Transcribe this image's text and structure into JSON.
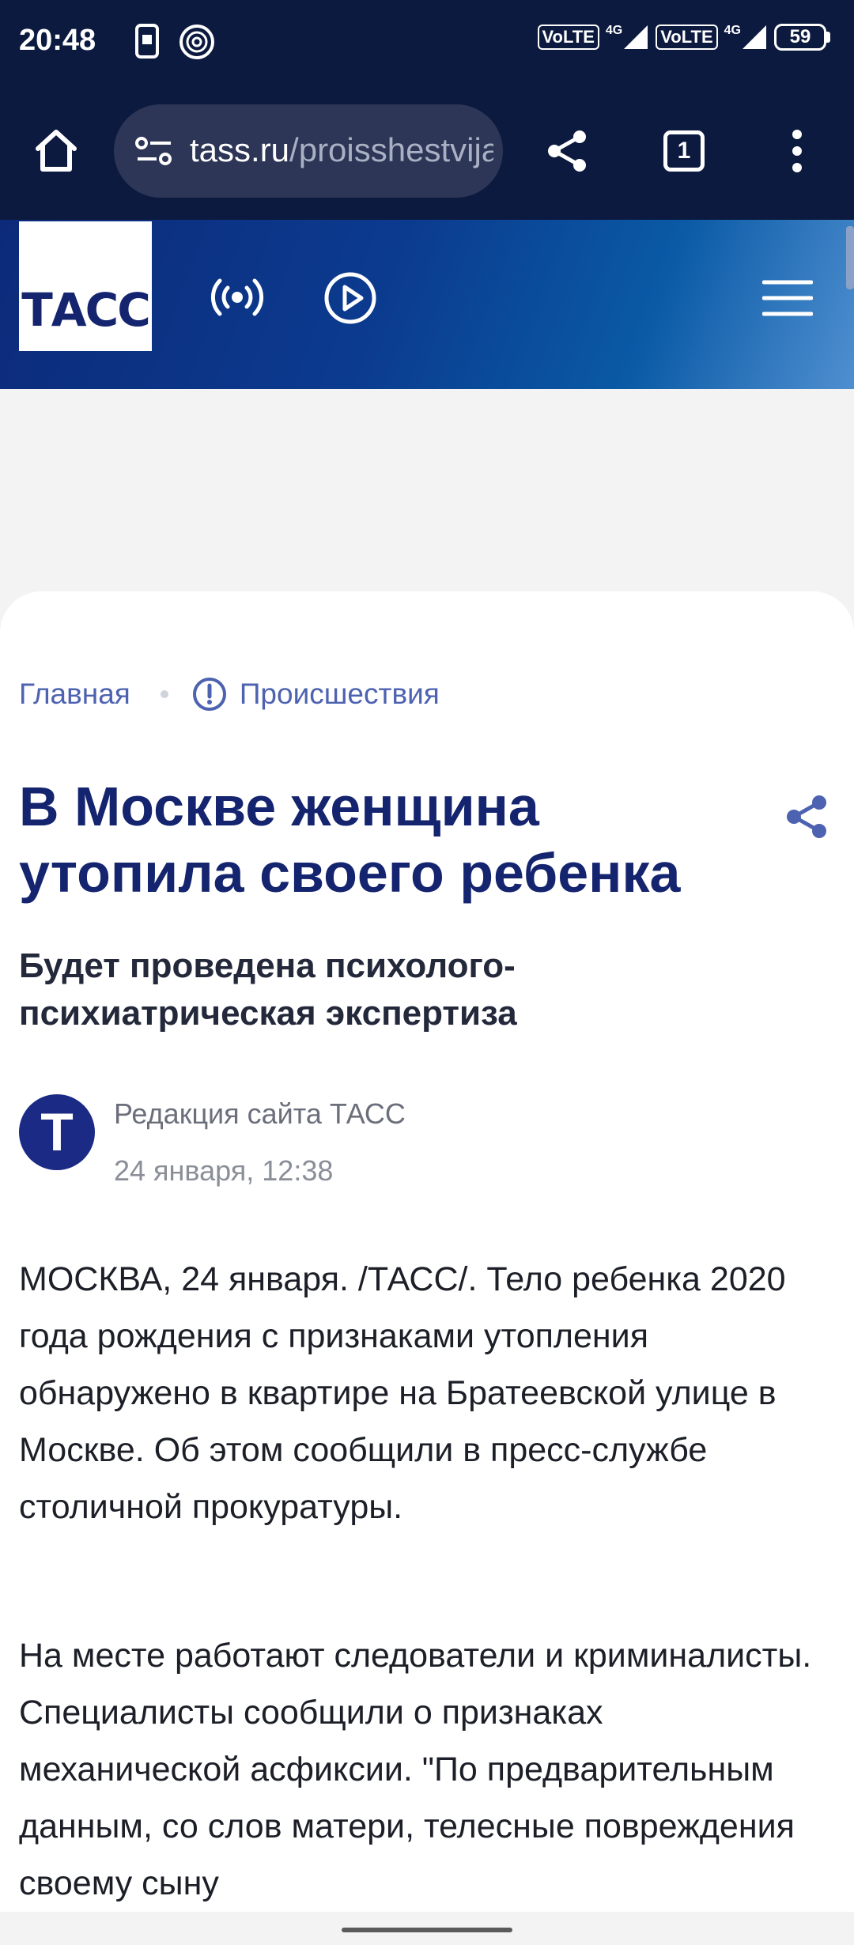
{
  "status_bar": {
    "time": "20:48",
    "network_1": "VoLTE",
    "network_2": "VoLTE",
    "signal_1": "4G",
    "signal_2": "4G",
    "battery": "59",
    "icons": [
      "sim-card-icon",
      "fingerprint-icon",
      "signal-icon",
      "battery-icon"
    ]
  },
  "browser": {
    "url_host": "tass.ru",
    "url_path": "/proisshestvija",
    "tab_count": "1",
    "icons": [
      "home-icon",
      "site-settings-icon",
      "share-icon",
      "tabs-icon",
      "more-icon"
    ]
  },
  "site": {
    "logo": "ТАСС",
    "icons": [
      "radio-icon",
      "play-icon",
      "menu-icon"
    ],
    "colors": {
      "header": "#0b3b8f",
      "title": "#14246e",
      "link": "#4d62b0"
    }
  },
  "article": {
    "breadcrumb": {
      "home": "Главная",
      "section": "Происшествия"
    },
    "title": "В Москве женщина утопила своего ребенка",
    "subtitle": "Будет проведена психолого-психиатрическая экспертиза",
    "author_initial": "Т",
    "author": "Редакция сайта ТАСС",
    "date": "24 января, 12:38",
    "paragraphs": [
      "МОСКВА, 24 января. /ТАСС/. Тело ребенка 2020 года рождения с признаками утопления обнаружено в квартире на Братеевской улице в Москве. Об этом сообщили в пресс-службе столичной прокуратуры.",
      "На месте работают следователи и криминалисты. Специалисты сообщили о признаках механической асфиксии. \"По предварительным данным, со слов матери, телесные повреждения своему сыну"
    ]
  }
}
